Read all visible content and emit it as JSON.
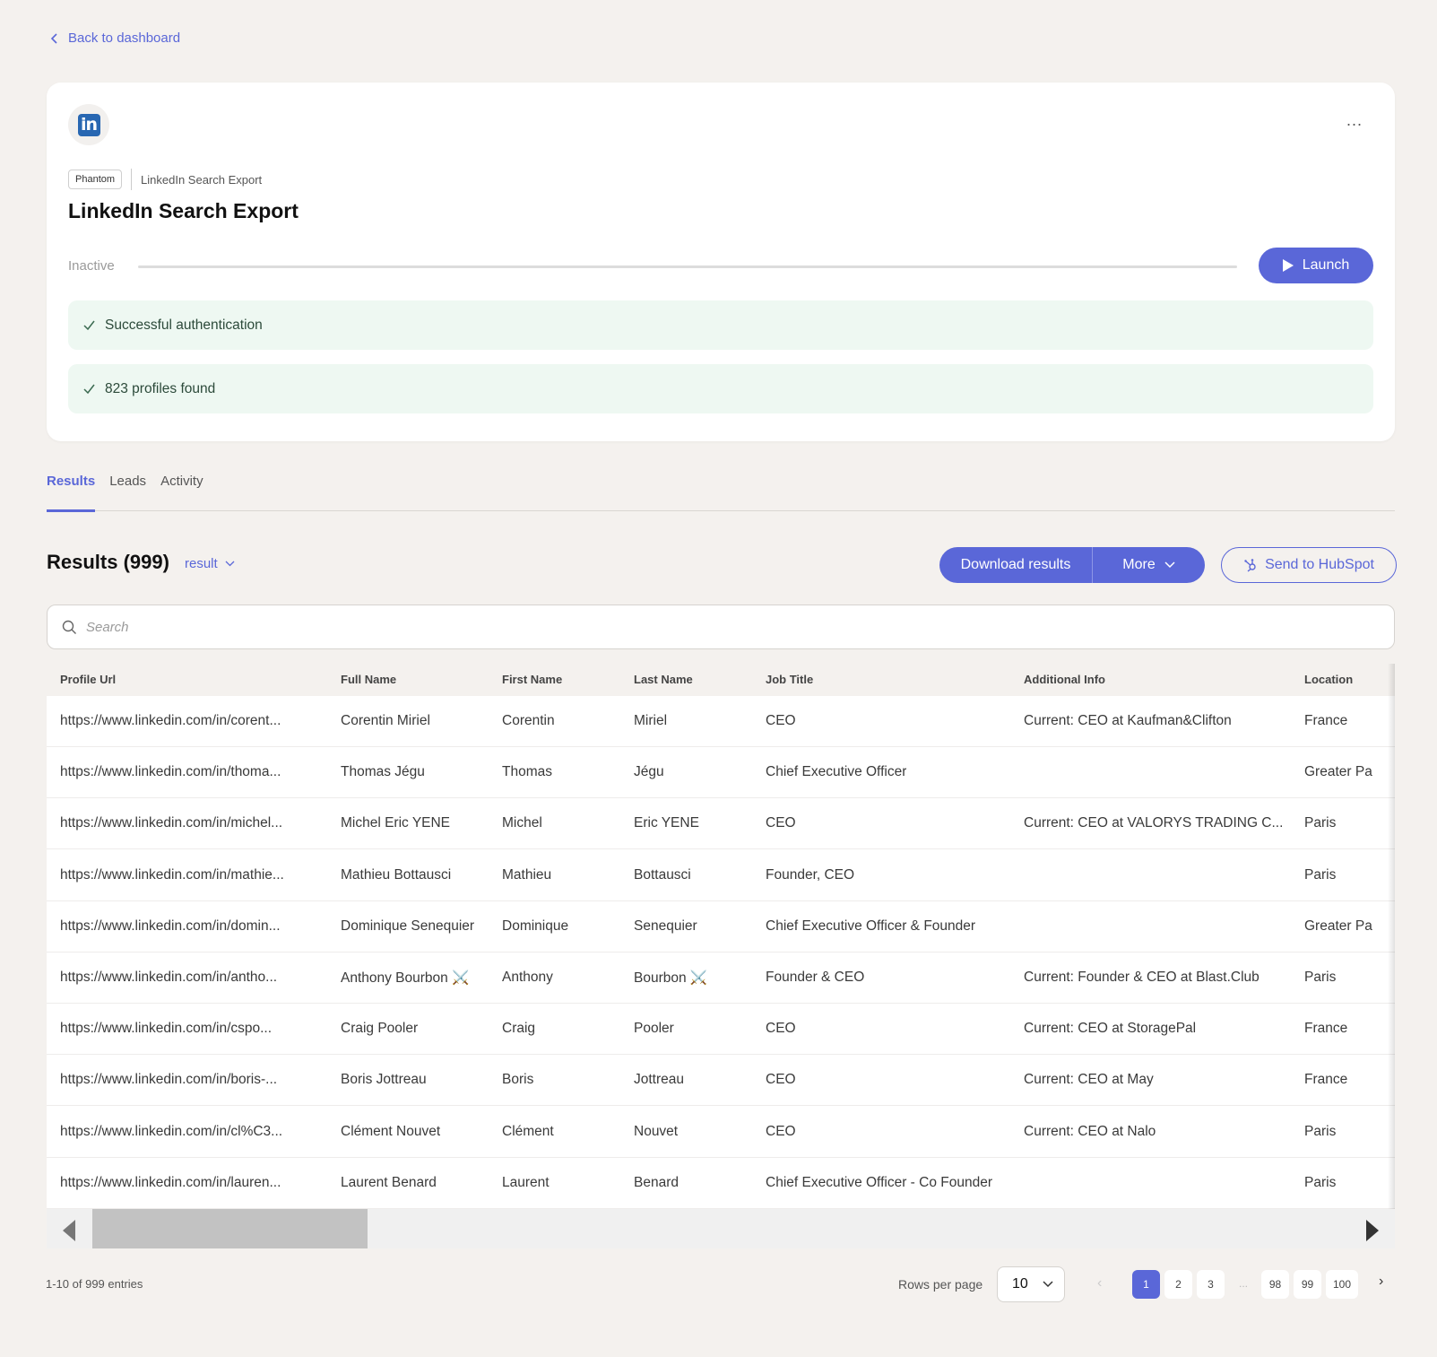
{
  "nav": {
    "back_label": "Back to dashboard"
  },
  "card": {
    "badge": "Phantom",
    "breadcrumb": "LinkedIn Search Export",
    "title": "LinkedIn Search Export",
    "status": "Inactive",
    "launch_label": "Launch",
    "more_label": "...",
    "logo_text": "in",
    "notices": [
      "Successful authentication",
      "823 profiles found"
    ]
  },
  "tabs": [
    {
      "label": "Results",
      "active": true
    },
    {
      "label": "Leads",
      "active": false
    },
    {
      "label": "Activity",
      "active": false
    }
  ],
  "results": {
    "title": "Results (999)",
    "selector_label": "result",
    "download_label": "Download results",
    "more_label": "More",
    "hubspot_label": "Send to HubSpot"
  },
  "search": {
    "placeholder": "Search",
    "value": ""
  },
  "table": {
    "columns": [
      "Profile Url",
      "Full Name",
      "First Name",
      "Last Name",
      "Job Title",
      "Additional Info",
      "Location"
    ],
    "rows": [
      [
        "https://www.linkedin.com/in/corent...",
        "Corentin Miriel",
        "Corentin",
        "Miriel",
        "CEO",
        "Current: CEO at Kaufman&Clifton",
        "France"
      ],
      [
        "https://www.linkedin.com/in/thoma...",
        "Thomas Jégu",
        "Thomas",
        "Jégu",
        "Chief Executive Officer",
        "",
        "Greater Pa"
      ],
      [
        "https://www.linkedin.com/in/michel...",
        "Michel Eric YENE",
        "Michel",
        "Eric YENE",
        "CEO",
        "Current: CEO at VALORYS TRADING C...",
        "Paris"
      ],
      [
        "https://www.linkedin.com/in/mathie...",
        "Mathieu Bottausci",
        "Mathieu",
        "Bottausci",
        "Founder, CEO",
        "",
        "Paris"
      ],
      [
        "https://www.linkedin.com/in/domin...",
        "Dominique Senequier",
        "Dominique",
        "Senequier",
        "Chief Executive Officer & Founder",
        "",
        "Greater Pa"
      ],
      [
        "https://www.linkedin.com/in/antho...",
        "Anthony Bourbon ⚔️",
        "Anthony",
        "Bourbon ⚔️",
        "Founder & CEO",
        "Current: Founder & CEO at Blast.Club",
        "Paris"
      ],
      [
        "https://www.linkedin.com/in/cspo...",
        "Craig Pooler",
        "Craig",
        "Pooler",
        "CEO",
        "Current: CEO at StoragePal",
        "France"
      ],
      [
        "https://www.linkedin.com/in/boris-...",
        "Boris Jottreau",
        "Boris",
        "Jottreau",
        "CEO",
        "Current: CEO at May",
        "France"
      ],
      [
        "https://www.linkedin.com/in/cl%C3...",
        "Clément Nouvet",
        "Clément",
        "Nouvet",
        "CEO",
        "Current: CEO at Nalo",
        "Paris"
      ],
      [
        "https://www.linkedin.com/in/lauren...",
        "Laurent Benard",
        "Laurent",
        "Benard",
        "Chief Executive Officer - Co Founder",
        "",
        "Paris"
      ]
    ]
  },
  "footer": {
    "entries": "1-10 of 999 entries",
    "rows_per_page_label": "Rows per page",
    "rows_per_page": "10",
    "pages": [
      "1",
      "2",
      "3",
      "98",
      "99",
      "100"
    ],
    "current_page": "1",
    "ellipsis": "...",
    "prev": "‹",
    "next": "›"
  },
  "colors": {
    "accent": "#5a67d8",
    "linkedin": "#2867b2",
    "success_bg": "#eef8f2",
    "background": "#f4f1ee"
  }
}
